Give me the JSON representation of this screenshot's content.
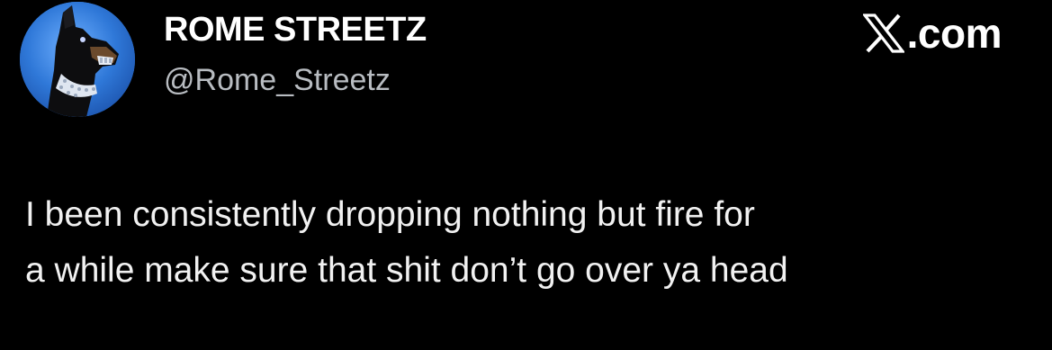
{
  "tweet": {
    "author": {
      "display_name": "ROME STREETZ",
      "handle": "@Rome_Streetz",
      "avatar_icon": "doberman-avatar-icon"
    },
    "brand": {
      "logo_icon": "x-logo-icon",
      "label": ".com"
    },
    "text_lines": [
      "I been consistently dropping nothing but fire for",
      "a while make sure that shit don’t go over ya head"
    ]
  },
  "colors": {
    "background": "#000000",
    "name": "#ffffff",
    "handle": "#b8bcc1",
    "body_text": "#f1f1f1",
    "avatar_bg": "#2f78d8"
  }
}
